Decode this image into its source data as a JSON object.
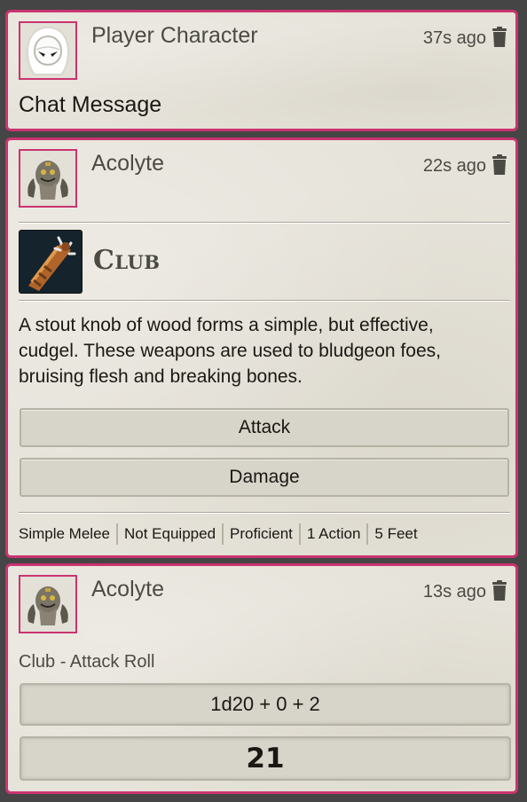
{
  "messages": [
    {
      "speaker": "Player Character",
      "timestamp": "37s ago",
      "content": "Chat Message",
      "portrait_icon": "hooded-figure-icon"
    },
    {
      "speaker": "Acolyte",
      "timestamp": "22s ago",
      "portrait_icon": "acolyte-token-icon",
      "item": {
        "name": "Club",
        "image_icon": "club-weapon-icon",
        "description": "A stout knob of wood forms a simple, but effective, cudgel. These weapons are used to bludgeon foes, bruising flesh and breaking bones.",
        "buttons": [
          "Attack",
          "Damage"
        ],
        "properties": [
          "Simple Melee",
          "Not Equipped",
          "Proficient",
          "1 Action",
          "5 Feet"
        ]
      }
    },
    {
      "speaker": "Acolyte",
      "timestamp": "13s ago",
      "portrait_icon": "acolyte-token-icon",
      "flavor": "Club - Attack Roll",
      "roll": {
        "formula": "1d20 + 0 + 2",
        "total": "21"
      }
    }
  ],
  "colors": {
    "accent_border": "#c9346f",
    "card_background": "#e6e3da",
    "button_background": "#d7d4ca",
    "text_dark": "#191813",
    "text_muted": "#4b4a44"
  }
}
